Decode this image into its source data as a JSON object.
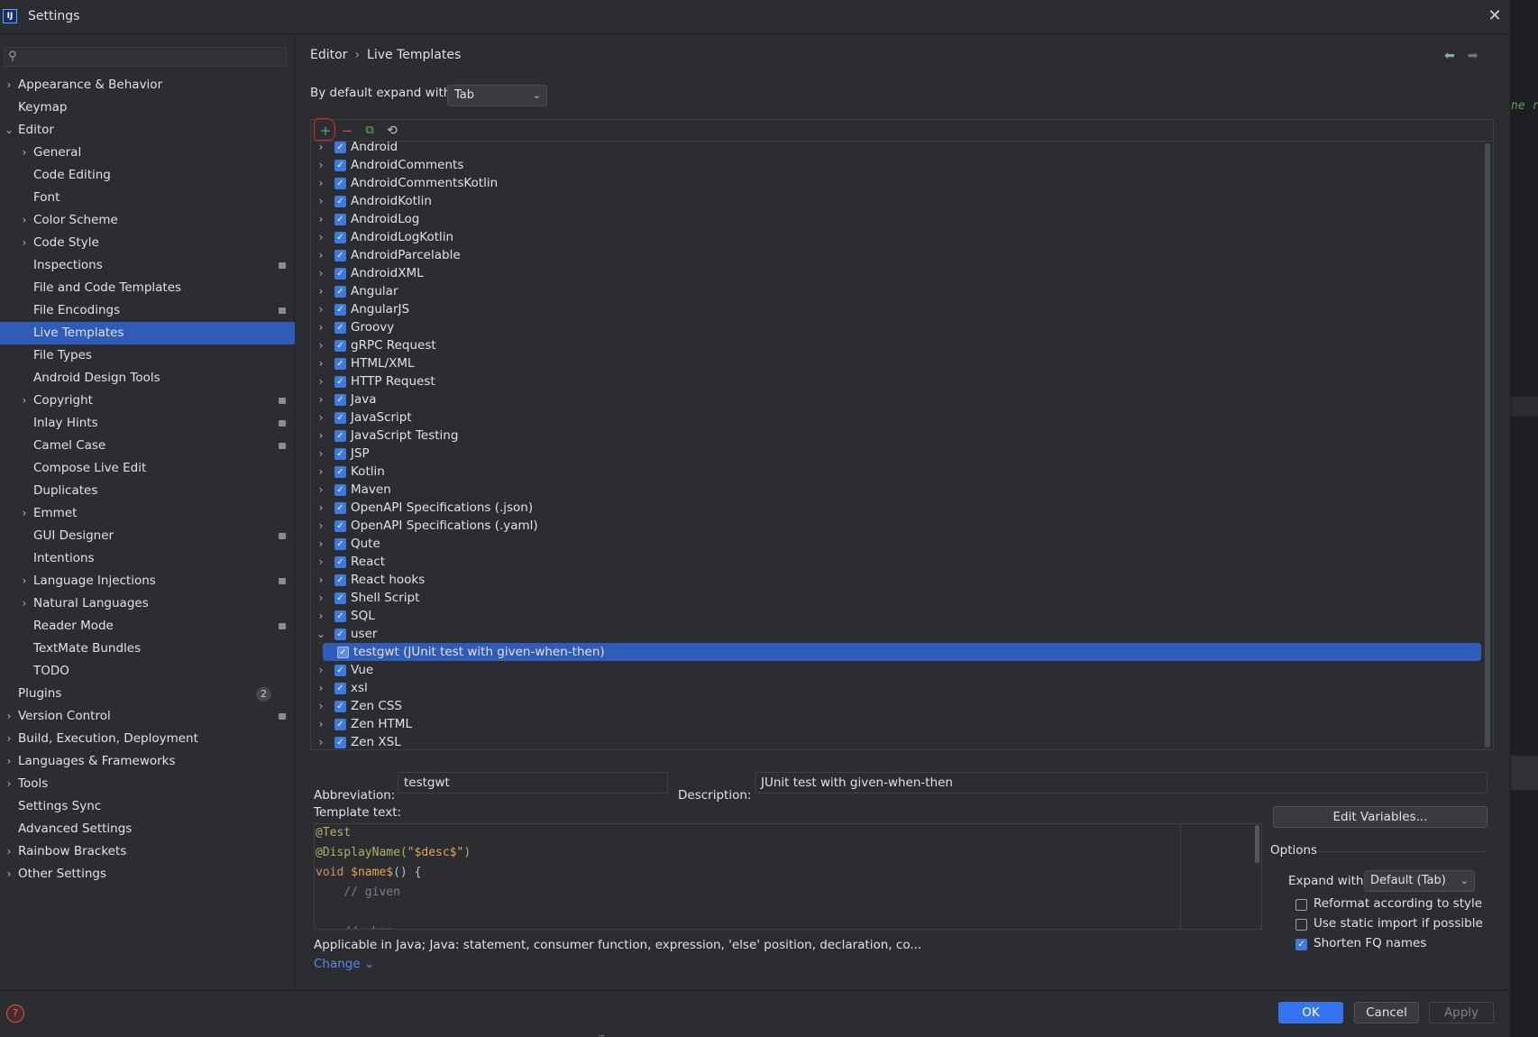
{
  "window": {
    "title": "Settings"
  },
  "search": {
    "placeholder": ""
  },
  "background_editor": {
    "code_fragment": "ne re",
    "footer_peek": "T"
  },
  "nav": {
    "items": [
      {
        "label": "Appearance & Behavior",
        "level": 0,
        "expandable": true,
        "expanded": false,
        "badge": false,
        "name": "appearance-behavior"
      },
      {
        "label": "Keymap",
        "level": 0,
        "expandable": false,
        "badge": false,
        "name": "keymap"
      },
      {
        "label": "Editor",
        "level": 0,
        "expandable": true,
        "expanded": true,
        "badge": false,
        "name": "editor"
      },
      {
        "label": "General",
        "level": 1,
        "expandable": true,
        "expanded": false,
        "badge": false,
        "name": "general"
      },
      {
        "label": "Code Editing",
        "level": 1,
        "expandable": false,
        "badge": false,
        "name": "code-editing"
      },
      {
        "label": "Font",
        "level": 1,
        "expandable": false,
        "badge": false,
        "name": "font"
      },
      {
        "label": "Color Scheme",
        "level": 1,
        "expandable": true,
        "expanded": false,
        "badge": false,
        "name": "color-scheme"
      },
      {
        "label": "Code Style",
        "level": 1,
        "expandable": true,
        "expanded": false,
        "badge": false,
        "name": "code-style"
      },
      {
        "label": "Inspections",
        "level": 1,
        "expandable": false,
        "badge": true,
        "name": "inspections"
      },
      {
        "label": "File and Code Templates",
        "level": 1,
        "expandable": false,
        "badge": false,
        "name": "file-and-code-templates"
      },
      {
        "label": "File Encodings",
        "level": 1,
        "expandable": false,
        "badge": true,
        "name": "file-encodings"
      },
      {
        "label": "Live Templates",
        "level": 1,
        "expandable": false,
        "badge": false,
        "selected": true,
        "name": "live-templates"
      },
      {
        "label": "File Types",
        "level": 1,
        "expandable": false,
        "badge": false,
        "name": "file-types"
      },
      {
        "label": "Android Design Tools",
        "level": 1,
        "expandable": false,
        "badge": false,
        "name": "android-design-tools"
      },
      {
        "label": "Copyright",
        "level": 1,
        "expandable": true,
        "expanded": false,
        "badge": true,
        "name": "copyright"
      },
      {
        "label": "Inlay Hints",
        "level": 1,
        "expandable": false,
        "badge": true,
        "name": "inlay-hints"
      },
      {
        "label": "Camel Case",
        "level": 1,
        "expandable": false,
        "badge": true,
        "name": "camel-case"
      },
      {
        "label": "Compose Live Edit",
        "level": 1,
        "expandable": false,
        "badge": false,
        "name": "compose-live-edit"
      },
      {
        "label": "Duplicates",
        "level": 1,
        "expandable": false,
        "badge": false,
        "name": "duplicates"
      },
      {
        "label": "Emmet",
        "level": 1,
        "expandable": true,
        "expanded": false,
        "badge": false,
        "name": "emmet"
      },
      {
        "label": "GUI Designer",
        "level": 1,
        "expandable": false,
        "badge": true,
        "name": "gui-designer"
      },
      {
        "label": "Intentions",
        "level": 1,
        "expandable": false,
        "badge": false,
        "name": "intentions"
      },
      {
        "label": "Language Injections",
        "level": 1,
        "expandable": true,
        "expanded": false,
        "badge": true,
        "name": "language-injections"
      },
      {
        "label": "Natural Languages",
        "level": 1,
        "expandable": true,
        "expanded": false,
        "badge": false,
        "name": "natural-languages"
      },
      {
        "label": "Reader Mode",
        "level": 1,
        "expandable": false,
        "badge": true,
        "name": "reader-mode"
      },
      {
        "label": "TextMate Bundles",
        "level": 1,
        "expandable": false,
        "badge": false,
        "name": "textmate-bundles"
      },
      {
        "label": "TODO",
        "level": 1,
        "expandable": false,
        "badge": false,
        "name": "todo"
      },
      {
        "label": "Plugins",
        "level": 0,
        "expandable": false,
        "badge": false,
        "count": "2",
        "name": "plugins"
      },
      {
        "label": "Version Control",
        "level": 0,
        "expandable": true,
        "expanded": false,
        "badge": true,
        "name": "version-control"
      },
      {
        "label": "Build, Execution, Deployment",
        "level": 0,
        "expandable": true,
        "expanded": false,
        "badge": false,
        "name": "build-execution-deployment"
      },
      {
        "label": "Languages & Frameworks",
        "level": 0,
        "expandable": true,
        "expanded": false,
        "badge": false,
        "name": "languages-frameworks"
      },
      {
        "label": "Tools",
        "level": 0,
        "expandable": true,
        "expanded": false,
        "badge": false,
        "name": "tools"
      },
      {
        "label": "Settings Sync",
        "level": 0,
        "expandable": false,
        "badge": false,
        "name": "settings-sync"
      },
      {
        "label": "Advanced Settings",
        "level": 0,
        "expandable": false,
        "badge": false,
        "name": "advanced-settings"
      },
      {
        "label": "Rainbow Brackets",
        "level": 0,
        "expandable": true,
        "expanded": false,
        "badge": false,
        "name": "rainbow-brackets"
      },
      {
        "label": "Other Settings",
        "level": 0,
        "expandable": true,
        "expanded": false,
        "badge": false,
        "name": "other-settings"
      }
    ]
  },
  "breadcrumb": {
    "parent": "Editor",
    "separator": "›",
    "current": "Live Templates"
  },
  "expand_default": {
    "label": "By default expand with",
    "value": "Tab"
  },
  "toolbar": {
    "add": "+",
    "remove": "−",
    "copy": "⧉",
    "revert": "⟲"
  },
  "templates": {
    "groups": [
      {
        "label": "Android",
        "checked": true,
        "expanded": false
      },
      {
        "label": "AndroidComments",
        "checked": true,
        "expanded": false
      },
      {
        "label": "AndroidCommentsKotlin",
        "checked": true,
        "expanded": false
      },
      {
        "label": "AndroidKotlin",
        "checked": true,
        "expanded": false
      },
      {
        "label": "AndroidLog",
        "checked": true,
        "expanded": false
      },
      {
        "label": "AndroidLogKotlin",
        "checked": true,
        "expanded": false
      },
      {
        "label": "AndroidParcelable",
        "checked": true,
        "expanded": false
      },
      {
        "label": "AndroidXML",
        "checked": true,
        "expanded": false
      },
      {
        "label": "Angular",
        "checked": true,
        "expanded": false
      },
      {
        "label": "AngularJS",
        "checked": true,
        "expanded": false
      },
      {
        "label": "Groovy",
        "checked": true,
        "expanded": false
      },
      {
        "label": "gRPC Request",
        "checked": true,
        "expanded": false
      },
      {
        "label": "HTML/XML",
        "checked": true,
        "expanded": false
      },
      {
        "label": "HTTP Request",
        "checked": true,
        "expanded": false
      },
      {
        "label": "Java",
        "checked": true,
        "expanded": false
      },
      {
        "label": "JavaScript",
        "checked": true,
        "expanded": false
      },
      {
        "label": "JavaScript Testing",
        "checked": true,
        "expanded": false
      },
      {
        "label": "JSP",
        "checked": true,
        "expanded": false
      },
      {
        "label": "Kotlin",
        "checked": true,
        "expanded": false
      },
      {
        "label": "Maven",
        "checked": true,
        "expanded": false
      },
      {
        "label": "OpenAPI Specifications (.json)",
        "checked": true,
        "expanded": false
      },
      {
        "label": "OpenAPI Specifications (.yaml)",
        "checked": true,
        "expanded": false
      },
      {
        "label": "Qute",
        "checked": true,
        "expanded": false
      },
      {
        "label": "React",
        "checked": true,
        "expanded": false
      },
      {
        "label": "React hooks",
        "checked": true,
        "expanded": false
      },
      {
        "label": "Shell Script",
        "checked": true,
        "expanded": false
      },
      {
        "label": "SQL",
        "checked": true,
        "expanded": false
      },
      {
        "label": "user",
        "checked": true,
        "expanded": true
      },
      {
        "label": "testgwt (JUnit test with given-when-then)",
        "checked": true,
        "child": true,
        "selected": true
      },
      {
        "label": "Vue",
        "checked": true,
        "expanded": false
      },
      {
        "label": "xsl",
        "checked": true,
        "expanded": false
      },
      {
        "label": "Zen CSS",
        "checked": true,
        "expanded": false
      },
      {
        "label": "Zen HTML",
        "checked": true,
        "expanded": false
      },
      {
        "label": "Zen XSL",
        "checked": true,
        "expanded": false
      }
    ]
  },
  "editor": {
    "abbreviation_label": "Abbreviation:",
    "abbreviation_value": "testgwt",
    "description_label": "Description:",
    "description_value": "JUnit test with given-when-then",
    "template_text_label": "Template text:",
    "code_lines": [
      [
        {
          "t": "@Test",
          "c": "ann"
        }
      ],
      [
        {
          "t": "@DisplayName(",
          "c": "ann"
        },
        {
          "t": "\"$desc$\"",
          "c": "var"
        },
        {
          "t": ")",
          "c": "ann"
        }
      ],
      [
        {
          "t": "void ",
          "c": "kw"
        },
        {
          "t": "$name$",
          "c": "var"
        },
        {
          "t": "() {",
          "c": "plain"
        }
      ],
      [
        {
          "t": "    // given",
          "c": "cm"
        }
      ],
      [
        {
          "t": "",
          "c": "plain"
        }
      ],
      [
        {
          "t": "    // when",
          "c": "cm"
        }
      ]
    ],
    "edit_variables": "Edit Variables...",
    "applicable": "Applicable in Java; Java: statement, consumer function, expression, 'else' position, declaration, co...",
    "change": "Change ⌄"
  },
  "options": {
    "header": "Options",
    "expand_with_label": "Expand with",
    "expand_with_value": "Default (Tab)",
    "reformat": {
      "label": "Reformat according to style",
      "checked": false
    },
    "static_import": {
      "label": "Use static import if possible",
      "checked": false
    },
    "shorten_fq": {
      "label": "Shorten FQ names",
      "checked": true
    }
  },
  "footer": {
    "ok": "OK",
    "cancel": "Cancel",
    "apply": "Apply",
    "help": "?"
  },
  "colors": {
    "accent": "#3574f0",
    "selection": "#2e5cb8",
    "checkbox": "#3d7be0",
    "background": "#2b2d30"
  }
}
